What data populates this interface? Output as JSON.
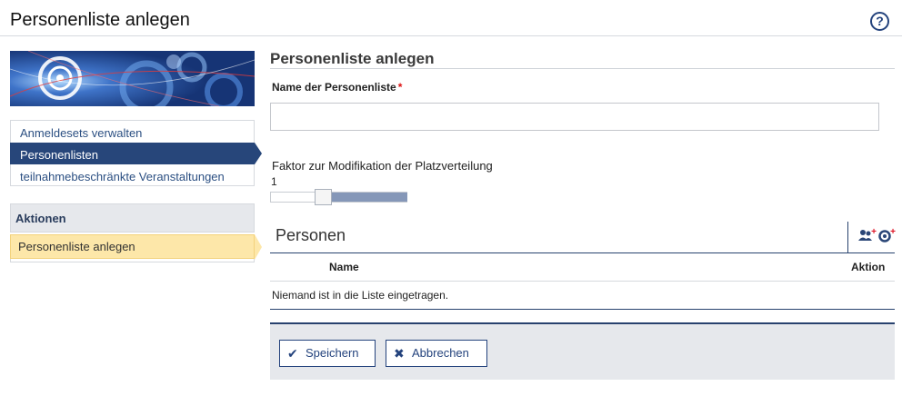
{
  "page": {
    "title": "Personenliste anlegen",
    "help_icon": "question-circle-icon",
    "help_glyph": "?"
  },
  "sidebar": {
    "nav": [
      {
        "label": "Anmeldesets verwalten",
        "active": false
      },
      {
        "label": "Personenlisten",
        "active": true
      },
      {
        "label": "teilnahmebeschränkte Veranstaltungen",
        "active": false
      }
    ],
    "actions_title": "Aktionen",
    "actions": [
      {
        "label": "Personenliste anlegen",
        "active": true
      }
    ]
  },
  "form": {
    "section_title": "Personenliste anlegen",
    "name_label": "Name der Personenliste",
    "required_marker": "*",
    "name_value": "",
    "factor_label": "Faktor zur Modifikation der Platzverteilung",
    "factor_value": "1"
  },
  "persons_table": {
    "caption": "Personen",
    "tools": [
      {
        "icon": "add-person-icon",
        "glyph": "👥",
        "plus": "+"
      },
      {
        "icon": "add-group-icon",
        "glyph": "↻",
        "plus": "+"
      }
    ],
    "columns": [
      "Name",
      "Aktion"
    ],
    "empty_message": "Niemand ist in die Liste eingetragen."
  },
  "buttons": {
    "save": {
      "label": "Speichern",
      "icon": "checkmark-icon",
      "glyph": "✔"
    },
    "cancel": {
      "label": "Abbrechen",
      "icon": "cross-icon",
      "glyph": "✖"
    }
  },
  "colors": {
    "primary": "#27467a",
    "action_highlight": "#fde7a9",
    "required": "#dd1111"
  }
}
